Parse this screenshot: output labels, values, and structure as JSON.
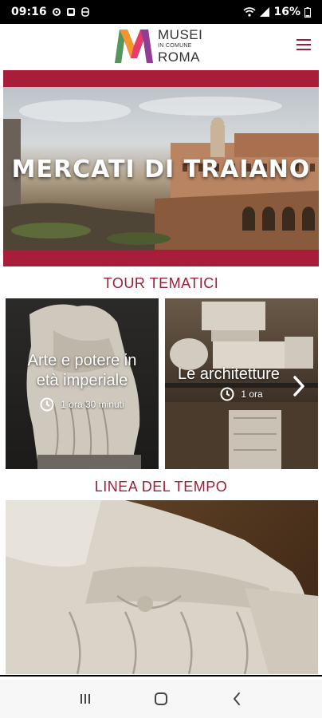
{
  "status": {
    "time": "09:16",
    "battery": "16%"
  },
  "header": {
    "logo_line1": "MUSEI",
    "logo_line2": "IN COMUNE",
    "logo_line3": "ROMA",
    "logo_letter": "M"
  },
  "hero": {
    "title": "MERCATI DI TRAIANO"
  },
  "sections": {
    "tours_title": "TOUR TEMATICI",
    "timeline_title": "LINEA DEL TEMPO"
  },
  "tours": [
    {
      "title_line1": "Arte e potere in",
      "title_line2": "età imperiale",
      "duration": "1 ora 30 minuti"
    },
    {
      "title_line1": "Le architetture",
      "duration": "1 ora"
    }
  ],
  "colors": {
    "accent": "#a01c3a",
    "hero_band": "#a81d3a"
  },
  "icons": {
    "clock": "clock-icon",
    "menu": "hamburger-menu-icon",
    "next": "chevron-right-icon"
  }
}
